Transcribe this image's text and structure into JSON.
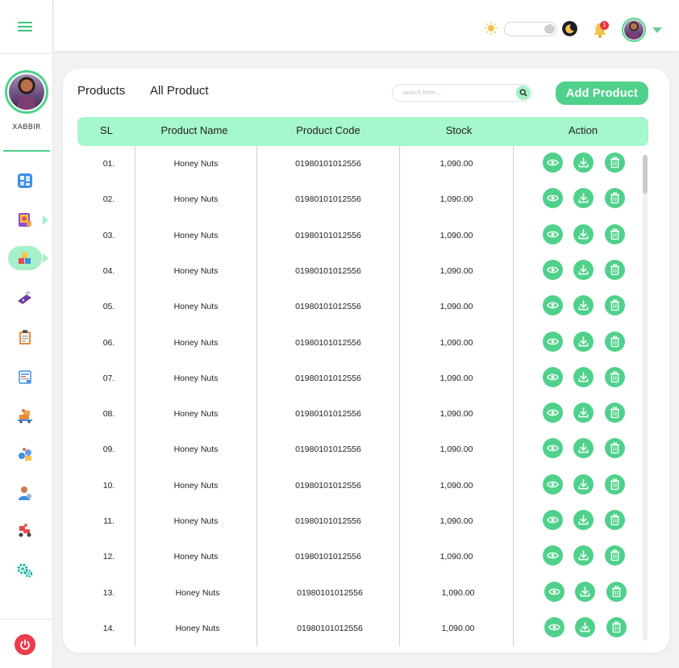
{
  "sidebar": {
    "username": "XABBIR",
    "nav": [
      {
        "icon": "dashboard-icon"
      },
      {
        "icon": "purchase-icon",
        "has_submenu": true
      },
      {
        "icon": "products-icon",
        "has_submenu": true,
        "active": true
      },
      {
        "icon": "pos-icon"
      },
      {
        "icon": "orders-clipboard-icon"
      },
      {
        "icon": "invoice-icon"
      },
      {
        "icon": "delivery-icon"
      },
      {
        "icon": "suppliers-icon"
      },
      {
        "icon": "customers-icon"
      },
      {
        "icon": "rider-icon"
      },
      {
        "icon": "settings-icon"
      }
    ],
    "logout_icon": "power-icon"
  },
  "topbar": {
    "notification_count": "1",
    "theme": "light"
  },
  "page": {
    "breadcrumb_1": "Products",
    "breadcrumb_2": "All Product",
    "search_placeholder": "search here...",
    "add_button": "Add Product"
  },
  "table": {
    "columns": [
      "SL",
      "Product Name",
      "Product Code",
      "Stock",
      "Action"
    ],
    "rows": [
      {
        "sl": "01.",
        "name": "Honey Nuts",
        "code": "01980101012556",
        "stock": "1,090.00"
      },
      {
        "sl": "02.",
        "name": "Honey Nuts",
        "code": "01980101012556",
        "stock": "1,090.00"
      },
      {
        "sl": "03.",
        "name": "Honey Nuts",
        "code": "01980101012556",
        "stock": "1,090.00"
      },
      {
        "sl": "04.",
        "name": "Honey Nuts",
        "code": "01980101012556",
        "stock": "1,090.00"
      },
      {
        "sl": "05.",
        "name": "Honey Nuts",
        "code": "01980101012556",
        "stock": "1,090.00"
      },
      {
        "sl": "06.",
        "name": "Honey Nuts",
        "code": "01980101012556",
        "stock": "1,090.00"
      },
      {
        "sl": "07.",
        "name": "Honey Nuts",
        "code": "01980101012556",
        "stock": "1,090.00"
      },
      {
        "sl": "08.",
        "name": "Honey Nuts",
        "code": "01980101012556",
        "stock": "1,090.00"
      },
      {
        "sl": "09.",
        "name": "Honey Nuts",
        "code": "01980101012556",
        "stock": "1,090.00"
      },
      {
        "sl": "10.",
        "name": "Honey Nuts",
        "code": "01980101012556",
        "stock": "1,090.00"
      },
      {
        "sl": "11.",
        "name": "Honey Nuts",
        "code": "01980101012556",
        "stock": "1,090.00"
      },
      {
        "sl": "12.",
        "name": "Honey Nuts",
        "code": "01980101012556",
        "stock": "1,090.00"
      },
      {
        "sl": "13.",
        "name": "Honey Nuts",
        "code": "01980101012556",
        "stock": "1,090.00"
      },
      {
        "sl": "14.",
        "name": "Honey Nuts",
        "code": "01980101012556",
        "stock": "1,090.00"
      }
    ],
    "actions": [
      "view-icon",
      "download-icon",
      "delete-icon"
    ]
  },
  "colors": {
    "accent": "#4fd18b",
    "header_bg": "#a6f7cb",
    "danger": "#ec3b4b"
  }
}
